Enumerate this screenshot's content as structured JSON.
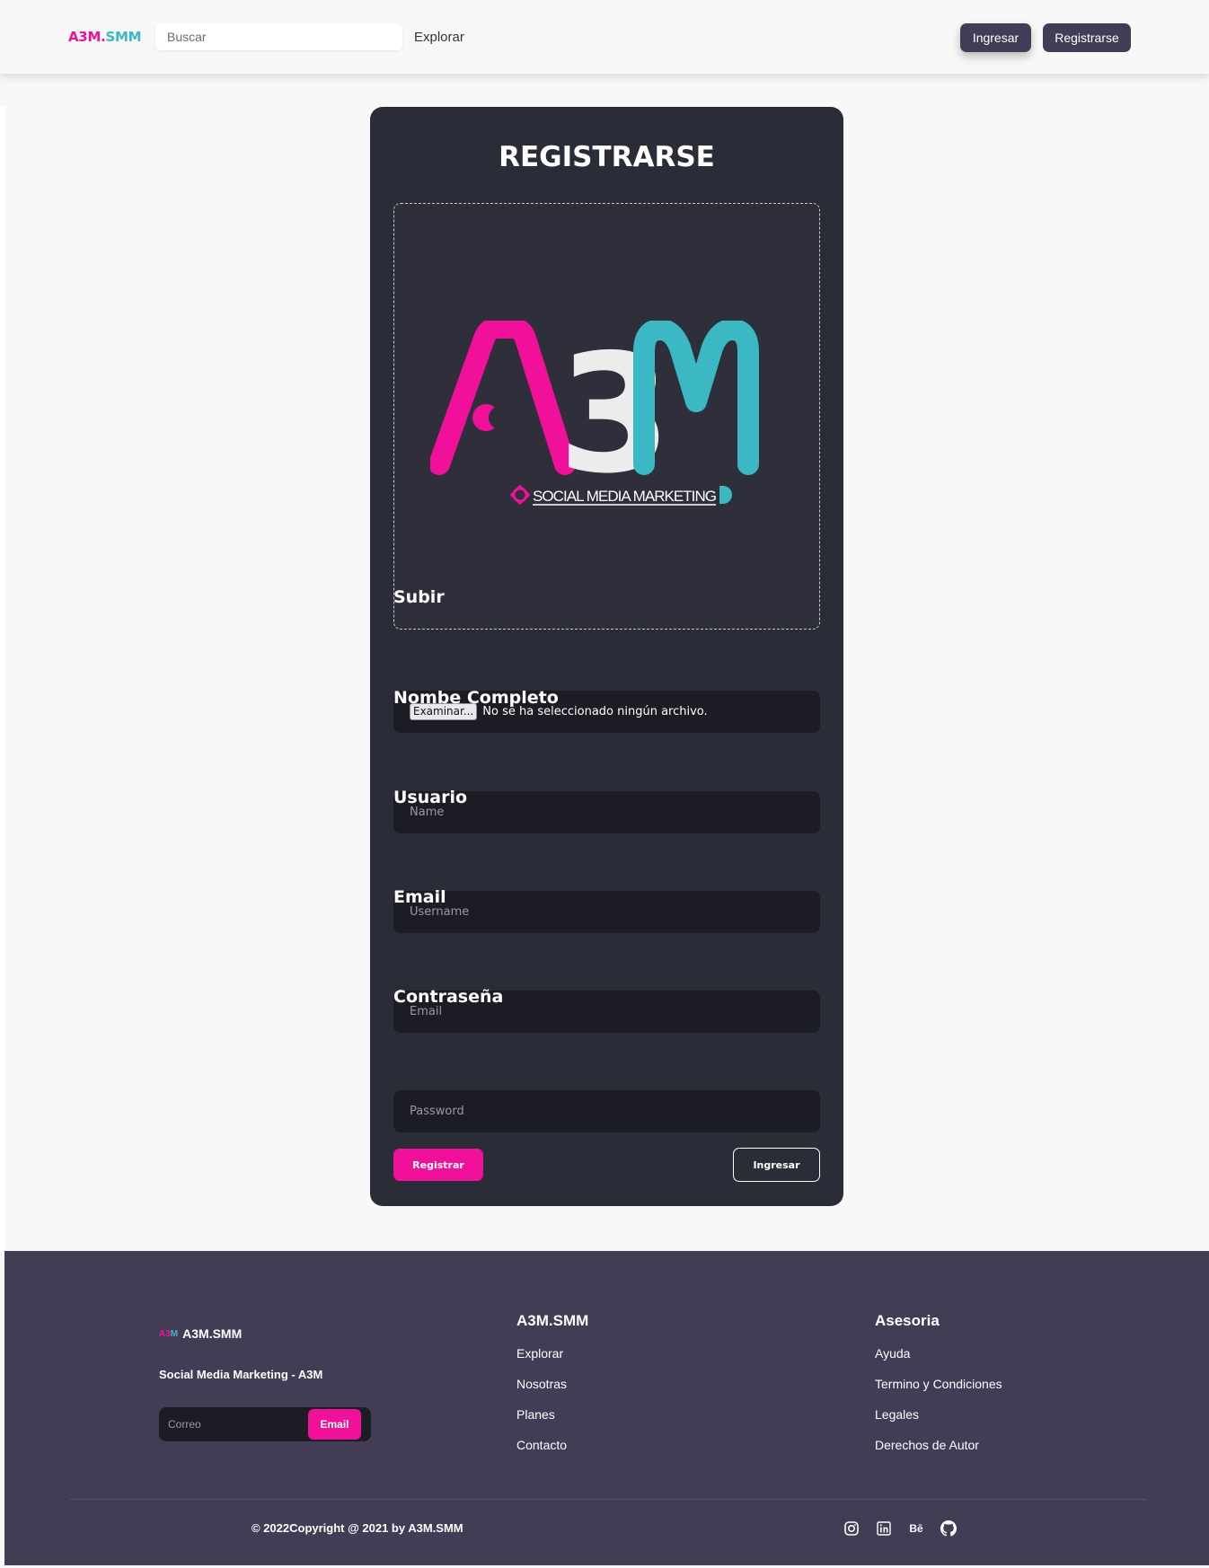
{
  "header": {
    "logo_part1": "A3M.",
    "logo_part2": "SMM",
    "search_placeholder": "Buscar",
    "nav_explorar": "Explorar",
    "btn_ingresar": "Ingresar",
    "btn_registrarse": "Registrarse"
  },
  "form": {
    "title": "REGISTRARSE",
    "logo_image": {
      "big_text_a": "A",
      "big_text_3": "3",
      "big_text_m": "M",
      "tagline": "SOCIAL MEDIA MARKETING"
    },
    "upload_label": "Subir",
    "file_button": "Examinar...",
    "file_status": "No se ha seleccionado ningún archivo.",
    "name_label": "Nombe Completo",
    "name_placeholder": "Name",
    "user_label": "Usuario",
    "user_placeholder": "Username",
    "email_label": "Email",
    "email_placeholder": "Email",
    "password_label": "Contraseña",
    "password_placeholder": "Password",
    "btn_registrar": "Registrar",
    "btn_ingresar": "Ingresar"
  },
  "footer": {
    "brand_mini_pink": "A3",
    "brand_mini_teal": "M",
    "brand_name": "A3M.SMM",
    "tagline": "Social Media Marketing - A3M",
    "newsletter_placeholder": "Correo",
    "newsletter_button": "Email",
    "col1": {
      "title": "A3M.SMM",
      "links": [
        "Explorar",
        "Nosotras",
        "Planes",
        "Contacto"
      ]
    },
    "col2": {
      "title": "Asesoria",
      "links": [
        "Ayuda",
        "Termino y Condiciones",
        "Legales",
        "Derechos de Autor"
      ]
    },
    "copyright": "© 2022Copyright @ 2021 by A3M.SMM",
    "social_icons": [
      "instagram-icon",
      "linkedin-icon",
      "behance-icon",
      "github-icon"
    ],
    "behance_text": "Bē"
  },
  "colors": {
    "accent_pink": "#f0109a",
    "accent_teal": "#3bb8c4",
    "card_bg": "#2a2d37",
    "footer_bg": "#423d55"
  }
}
